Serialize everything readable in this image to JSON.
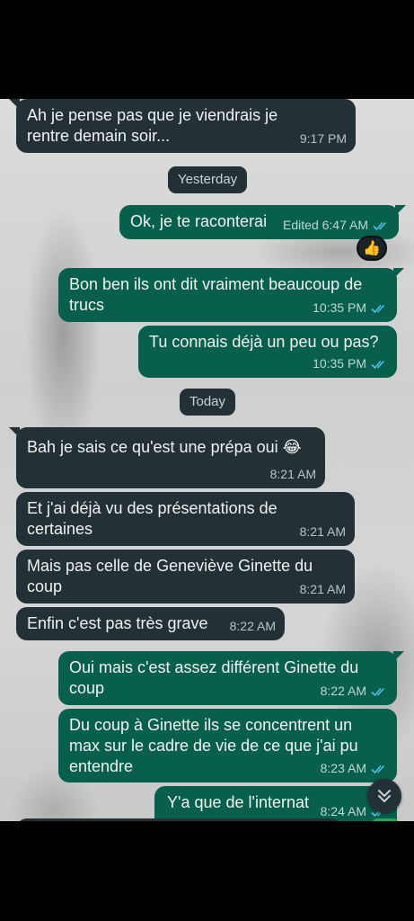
{
  "messages": [
    {
      "text": "Ah je pense pas que je viendrais je rentre demain soir...",
      "time": "9:17 PM"
    },
    {
      "text": "Ok, je te raconterai",
      "time": "Edited 6:47 AM",
      "reaction": "👍"
    },
    {
      "text": "Bon ben ils ont dit vraiment beaucoup de trucs",
      "time": "10:35 PM"
    },
    {
      "text": "Tu connais déjà un peu ou pas?",
      "time": "10:35 PM"
    },
    {
      "text": "Bah je sais ce qu'est une prépa oui 😂",
      "time": "8:21 AM"
    },
    {
      "text": "Et j'ai déjà vu des présentations de certaines",
      "time": "8:21 AM"
    },
    {
      "text": "Mais pas celle de Geneviève Ginette du coup",
      "time": "8:21 AM"
    },
    {
      "text": "Enfin c'est pas très grave",
      "time": "8:22 AM"
    },
    {
      "text": "Oui mais c'est assez différent Ginette du coup",
      "time": "8:22 AM"
    },
    {
      "text": "Du coup à Ginette ils se concentrent un max sur le cadre de vie de ce que j'ai pu entendre",
      "time": "8:23 AM"
    },
    {
      "text": "Y'a que de l'internat",
      "time": "8:24 AM"
    }
  ],
  "dates": {
    "yesterday": "Yesterday",
    "today": "Today"
  },
  "icons": {
    "read_ticks": "double-check-icon",
    "scroll_down": "chevron-double-down-icon"
  },
  "colors": {
    "incoming": "#233036",
    "outgoing": "#075f4c",
    "read_tick": "#53bdeb"
  }
}
